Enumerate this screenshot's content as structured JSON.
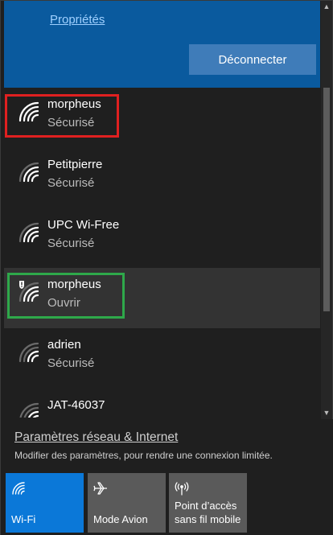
{
  "connected": {
    "properties_link": "Propriétés",
    "disconnect_label": "Déconnecter"
  },
  "networks": [
    {
      "name": "morpheus",
      "status": "Sécurisé",
      "secured": true,
      "highlight": "red"
    },
    {
      "name": "Petitpierre",
      "status": "Sécurisé",
      "secured": true
    },
    {
      "name": "UPC Wi-Free",
      "status": "Sécurisé",
      "secured": true
    },
    {
      "name": "morpheus",
      "status": "Ouvrir",
      "secured": false,
      "warning": true,
      "selected": true,
      "highlight": "green"
    },
    {
      "name": "adrien",
      "status": "Sécurisé",
      "secured": true
    },
    {
      "name": "JAT-46037",
      "status": "",
      "secured": true
    }
  ],
  "footer": {
    "settings_link": "Paramètres réseau & Internet",
    "settings_sub": "Modifier des paramètres, pour rendre une connexion limitée."
  },
  "tiles": [
    {
      "label": "Wi-Fi",
      "icon": "wifi-icon",
      "active": true
    },
    {
      "label": "Mode Avion",
      "icon": "airplane-icon",
      "active": false
    },
    {
      "label": "Point d’accès sans fil mobile",
      "label_line1": "Point d’accès",
      "label_line2": "sans fil mobile",
      "icon": "hotspot-icon",
      "active": false
    }
  ],
  "colors": {
    "accent": "#0b78d8",
    "connected_bg": "#0a5a9e",
    "panel_bg": "#1f1f1f",
    "highlight_red": "#e02020",
    "highlight_green": "#2ea84a"
  }
}
